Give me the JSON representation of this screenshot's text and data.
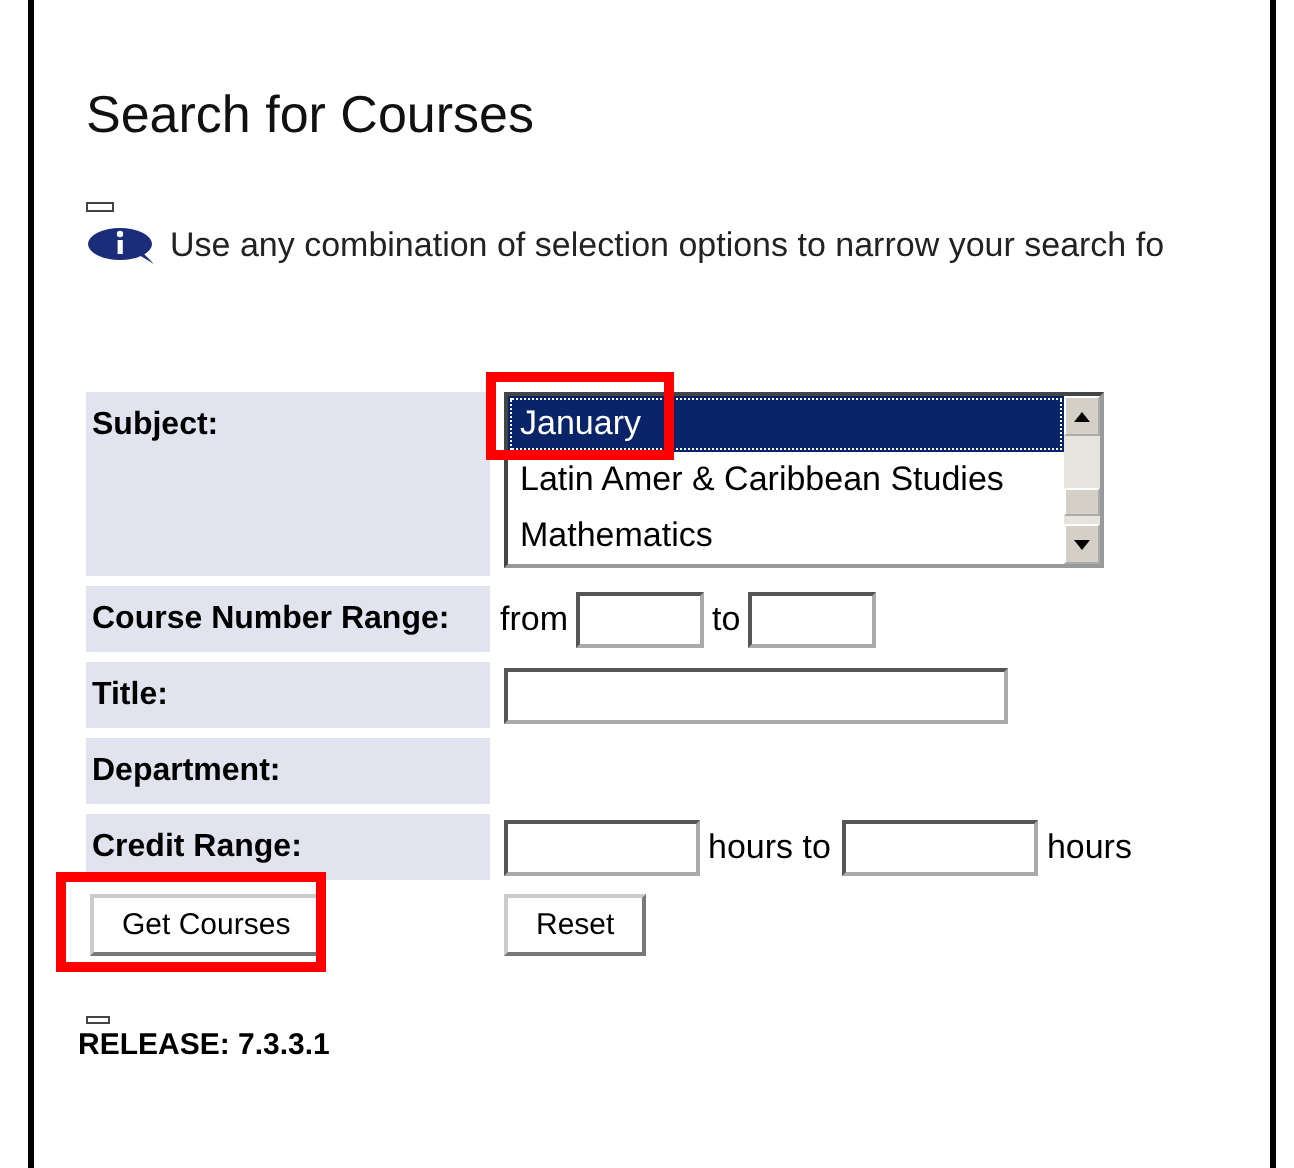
{
  "title": "Search for Courses",
  "info": "Use any combination of selection options to narrow your search fo",
  "subject": {
    "label": "Subject:",
    "options": [
      {
        "label": "January",
        "selected": true
      },
      {
        "label": "Latin Amer & Caribbean Studies",
        "selected": false
      },
      {
        "label": "Mathematics",
        "selected": false
      }
    ]
  },
  "course_number": {
    "label": "Course Number Range:",
    "from": "from",
    "to": "to"
  },
  "title_field": {
    "label": "Title:"
  },
  "department": {
    "label": "Department:"
  },
  "credit": {
    "label": "Credit Range:",
    "between": "hours to",
    "after": "hours"
  },
  "buttons": {
    "submit": "Get Courses",
    "reset": "Reset"
  },
  "release": "RELEASE: 7.3.3.1"
}
